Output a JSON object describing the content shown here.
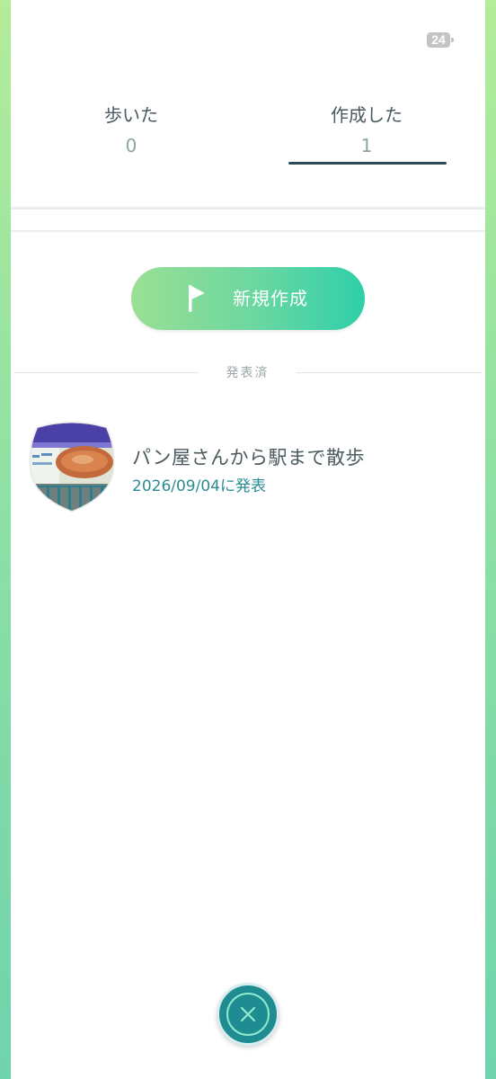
{
  "status_bar": {
    "battery": "24"
  },
  "tabs": [
    {
      "label": "歩いた",
      "count": "0",
      "selected": false
    },
    {
      "label": "作成した",
      "count": "1",
      "selected": true
    }
  ],
  "new_route_button": {
    "label": "新規作成",
    "icon": "flag-icon"
  },
  "section": {
    "published_label": "発表済"
  },
  "routes": [
    {
      "title": "パン屋さんから駅まで散歩",
      "date": "2026/09/04に発表",
      "thumbnail_icon": "route-badge-icon"
    }
  ],
  "close_button": {
    "icon": "close-icon"
  },
  "colors": {
    "accent_teal": "#1f8c92",
    "button_gradient_start": "#9bdf95",
    "button_gradient_end": "#2ecfaa",
    "date_text": "#2b8d93",
    "tab_underline": "#2c4d57"
  }
}
